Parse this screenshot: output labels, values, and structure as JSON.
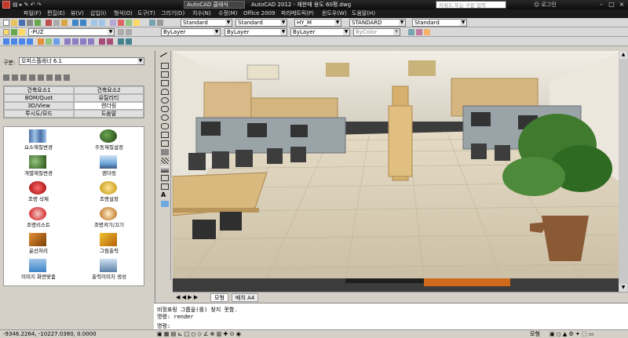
{
  "titlebar": {
    "menus": [
      "파일(F)",
      "편집(E)",
      "뷰(V)",
      "삽입(I)",
      "형식(O)",
      "도구(T)",
      "그리기(D)",
      "치수(N)",
      "수정(M)",
      "Office 2009",
      "파라메트릭(P)",
      "윈도우(W)",
      "도움말(H)"
    ],
    "workspace": "AutoCAD 클래식",
    "title": "AutoCAD 2012 - 재판매 용도 60평.dwg",
    "search_placeholder": "키워드 또는 구문 입력",
    "login": "로그인"
  },
  "toolbar": {
    "text_style": "Standard",
    "dim_style": "Standard",
    "annotation_scale": "HY_M",
    "layer": "-PUZ",
    "color": "ByLayer",
    "linetype": "ByLayer",
    "lineweight": "ByLayer",
    "plot_style": "ByColor",
    "table_style": "STANDARD",
    "multileader_style": "Standard"
  },
  "panel": {
    "category_label": "구분:",
    "category_value": "오피스플래너 6.1",
    "category_buttons": [
      "건축요소1",
      "건축요소2",
      "BOM/Quot",
      "유틸리티",
      "3D/View",
      "렌더링",
      "투시도/모드",
      "도움말"
    ],
    "tiles": [
      "요소재질변경",
      "주동재질설정",
      "개별재질변경",
      "렌더링",
      "조명 삭제",
      "조명설정",
      "조명리스트",
      "조명켜기/끄기",
      "윤선처리",
      "그림출력",
      "이미지 화면맞춤",
      "출력이미지 생성"
    ]
  },
  "tabs": [
    "모형",
    "배치 A4"
  ],
  "command": {
    "line1": "비정표링 그룹을(를) 찾지 못함.",
    "line2": "명령: render",
    "prompt": "명령:"
  },
  "status": {
    "coords": "-9346.2264, -10227.0380, 0.0000",
    "model": "모형"
  }
}
